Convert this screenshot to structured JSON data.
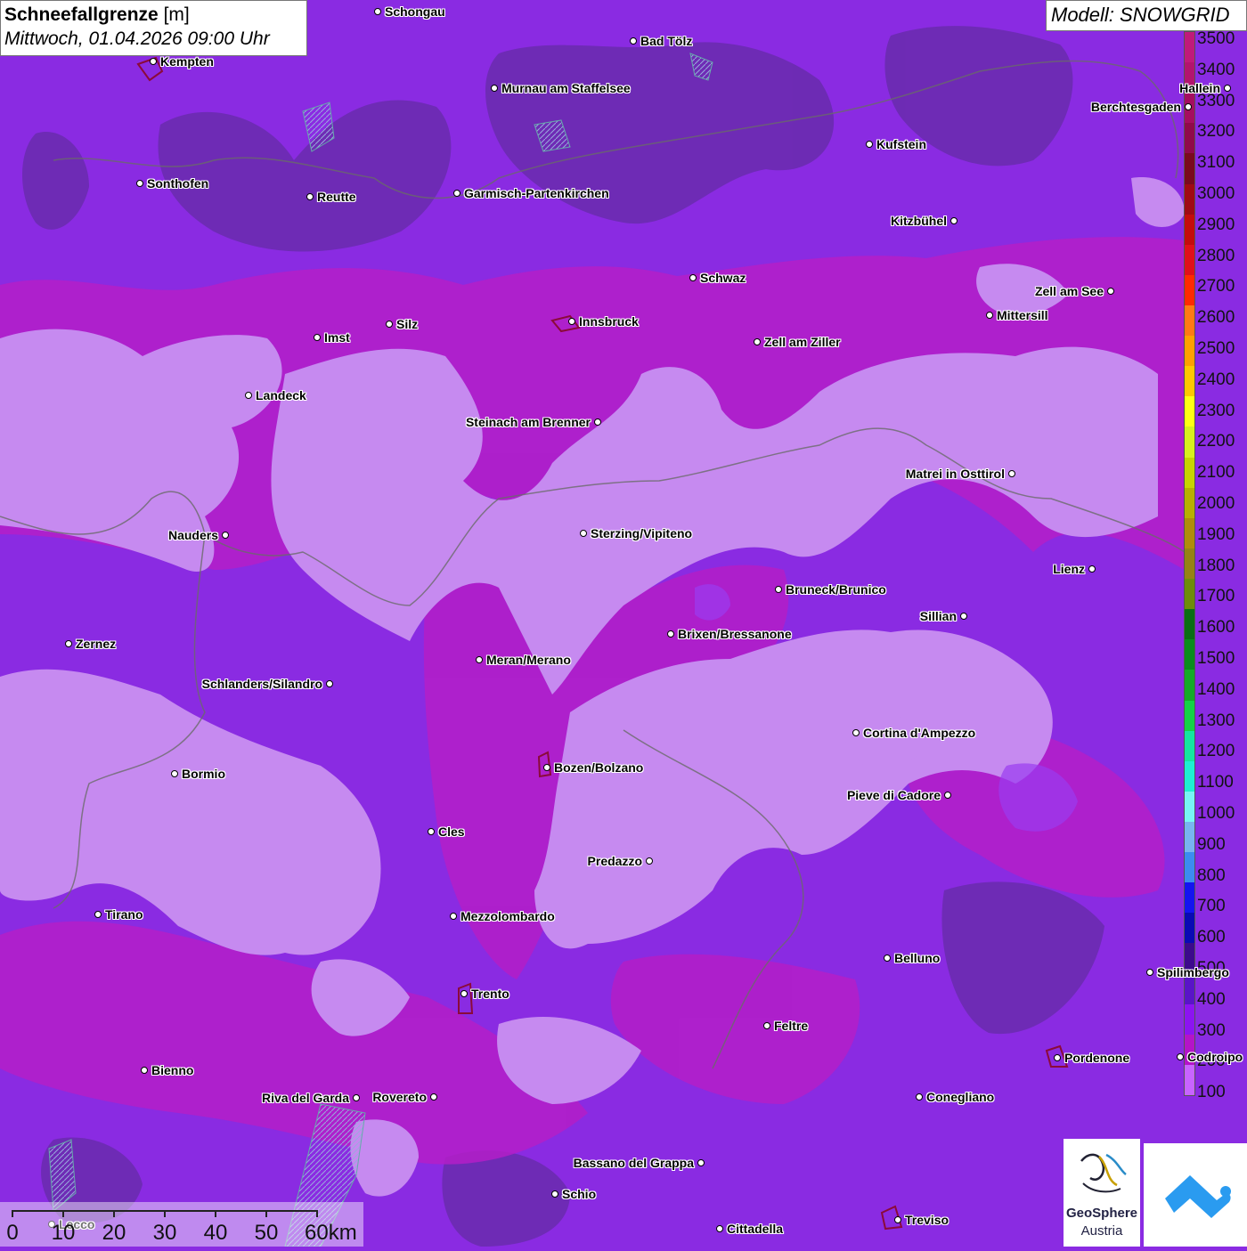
{
  "title": {
    "main": "Schneefallgrenze",
    "unit": "[m]",
    "datetime": "Mittwoch, 01.04.2026 09:00 Uhr"
  },
  "model": "Modell: SNOWGRID",
  "legend": {
    "levels": [
      {
        "label": "3500",
        "color": "#c01a7a"
      },
      {
        "label": "3400",
        "color": "#b3146e"
      },
      {
        "label": "3300",
        "color": "#a50e60"
      },
      {
        "label": "3200",
        "color": "#900a4a"
      },
      {
        "label": "3100",
        "color": "#7a0a1e"
      },
      {
        "label": "3000",
        "color": "#a00a14"
      },
      {
        "label": "2900",
        "color": "#c40c0c"
      },
      {
        "label": "2800",
        "color": "#e0101a"
      },
      {
        "label": "2700",
        "color": "#ff2a00"
      },
      {
        "label": "2600",
        "color": "#ff7a14"
      },
      {
        "label": "2500",
        "color": "#ffa000"
      },
      {
        "label": "2400",
        "color": "#ffc800"
      },
      {
        "label": "2300",
        "color": "#ffff14"
      },
      {
        "label": "2200",
        "color": "#d8f01e"
      },
      {
        "label": "2100",
        "color": "#c8d400"
      },
      {
        "label": "2000",
        "color": "#b8b000"
      },
      {
        "label": "1900",
        "color": "#b08c0a"
      },
      {
        "label": "1800",
        "color": "#968214"
      },
      {
        "label": "1700",
        "color": "#6e8c0a"
      },
      {
        "label": "1600",
        "color": "#0a6e14"
      },
      {
        "label": "1500",
        "color": "#0a8c1e"
      },
      {
        "label": "1400",
        "color": "#14aa28"
      },
      {
        "label": "1300",
        "color": "#14d246"
      },
      {
        "label": "1200",
        "color": "#14e6a0"
      },
      {
        "label": "1100",
        "color": "#1ef0d2"
      },
      {
        "label": "1000",
        "color": "#78f5f5"
      },
      {
        "label": "900",
        "color": "#78b4f0"
      },
      {
        "label": "800",
        "color": "#3c8cf0"
      },
      {
        "label": "700",
        "color": "#1414f0"
      },
      {
        "label": "600",
        "color": "#0a0ab4"
      },
      {
        "label": "500",
        "color": "#3c0a8c"
      },
      {
        "label": "400",
        "color": "#5a14c8"
      },
      {
        "label": "300",
        "color": "#8c14f0"
      },
      {
        "label": "200",
        "color": "#b414c8"
      },
      {
        "label": "100",
        "color": "#c864ff"
      }
    ]
  },
  "cities": [
    {
      "name": "Schongau"
    },
    {
      "name": "Bad Tölz"
    },
    {
      "name": "Kempten"
    },
    {
      "name": "Murnau am Staffelsee"
    },
    {
      "name": "Hallein"
    },
    {
      "name": "Berchtesgaden"
    },
    {
      "name": "Kufstein"
    },
    {
      "name": "Sonthofen"
    },
    {
      "name": "Reutte"
    },
    {
      "name": "Garmisch-Partenkirchen"
    },
    {
      "name": "Kitzbühel"
    },
    {
      "name": "Schwaz"
    },
    {
      "name": "Zell am See"
    },
    {
      "name": "Innsbruck"
    },
    {
      "name": "Mittersill"
    },
    {
      "name": "Silz"
    },
    {
      "name": "Imst"
    },
    {
      "name": "Zell am Ziller"
    },
    {
      "name": "Landeck"
    },
    {
      "name": "Steinach am Brenner"
    },
    {
      "name": "Matrei in Osttirol"
    },
    {
      "name": "Nauders"
    },
    {
      "name": "Sterzing/Vipiteno"
    },
    {
      "name": "Lienz"
    },
    {
      "name": "Bruneck/Brunico"
    },
    {
      "name": "Sillian"
    },
    {
      "name": "Brixen/Bressanone"
    },
    {
      "name": "Zernez"
    },
    {
      "name": "Meran/Merano"
    },
    {
      "name": "Schlanders/Silandro"
    },
    {
      "name": "Cortina d'Ampezzo"
    },
    {
      "name": "Bozen/Bolzano"
    },
    {
      "name": "Bormio"
    },
    {
      "name": "Pieve di Cadore"
    },
    {
      "name": "Cles"
    },
    {
      "name": "Predazzo"
    },
    {
      "name": "Tirano"
    },
    {
      "name": "Mezzolombardo"
    },
    {
      "name": "Belluno"
    },
    {
      "name": "Spilimbergo"
    },
    {
      "name": "Trento"
    },
    {
      "name": "Feltre"
    },
    {
      "name": "Pordenone"
    },
    {
      "name": "Codroipo"
    },
    {
      "name": "Bienno"
    },
    {
      "name": "Riva del Garda"
    },
    {
      "name": "Rovereto"
    },
    {
      "name": "Conegliano"
    },
    {
      "name": "Bassano del Grappa"
    },
    {
      "name": "Schio"
    },
    {
      "name": "Lecco"
    },
    {
      "name": "Treviso"
    },
    {
      "name": "Cittadella"
    }
  ],
  "scale": {
    "labels": [
      "0",
      "10",
      "20",
      "30",
      "40",
      "50",
      "60km"
    ]
  },
  "logos": {
    "geosphere_line1": "GeoSphere",
    "geosphere_line2": "Austria"
  }
}
